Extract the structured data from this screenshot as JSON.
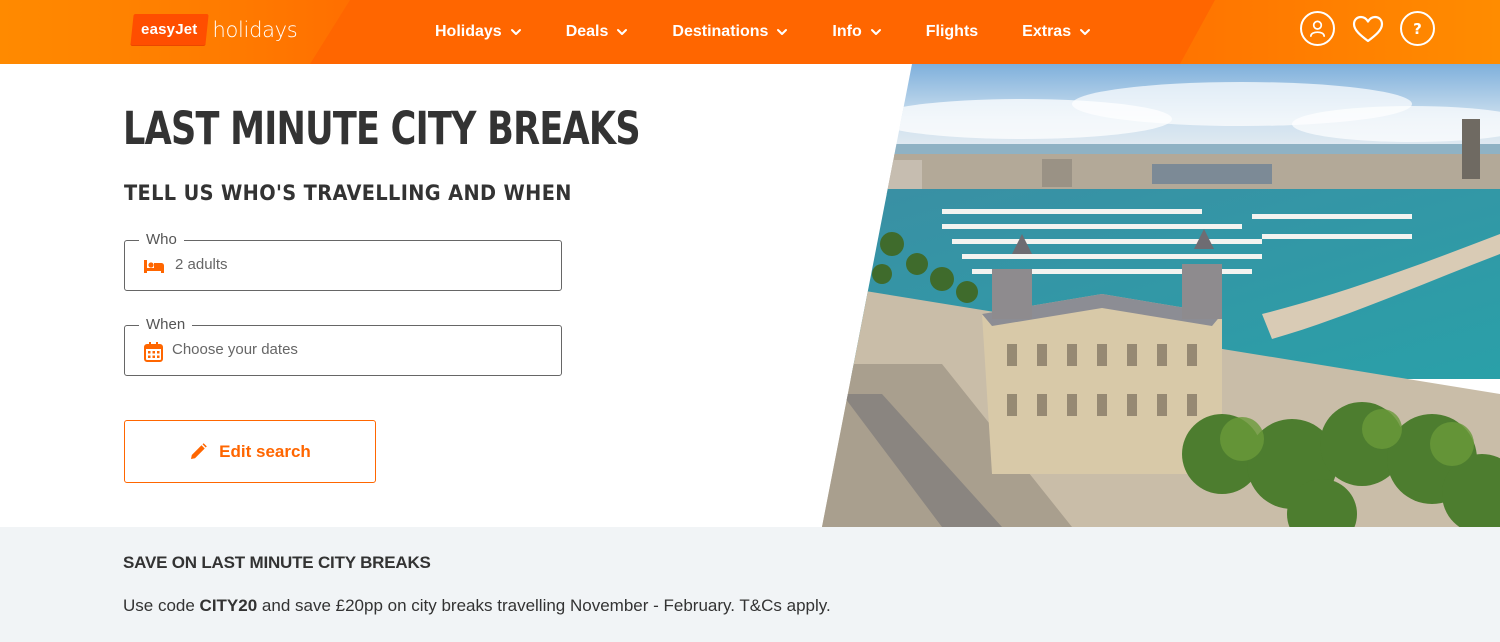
{
  "brand": {
    "logo_box": "easyJet",
    "logo_text": "holidays"
  },
  "nav": {
    "items": [
      {
        "label": "Holidays",
        "has_dropdown": true
      },
      {
        "label": "Deals",
        "has_dropdown": true
      },
      {
        "label": "Destinations",
        "has_dropdown": true
      },
      {
        "label": "Info",
        "has_dropdown": true
      },
      {
        "label": "Flights",
        "has_dropdown": false
      },
      {
        "label": "Extras",
        "has_dropdown": true
      }
    ]
  },
  "header_icons": {
    "account": "user-icon",
    "favourites": "heart-icon",
    "help": "help-icon",
    "help_glyph": "?"
  },
  "hero": {
    "title": "LAST MINUTE CITY BREAKS",
    "subtitle": "TELL US WHO'S TRAVELLING AND WHEN",
    "who": {
      "legend": "Who",
      "value": "2 adults",
      "icon": "bed-icon"
    },
    "when": {
      "legend": "When",
      "placeholder": "Choose your dates",
      "icon": "calendar-icon"
    },
    "edit_button": {
      "label": "Edit search",
      "icon": "pencil-icon"
    },
    "image_alt": "Aerial view of Port Vell harbour, Barcelona"
  },
  "promo": {
    "title": "SAVE ON LAST MINUTE CITY BREAKS",
    "text_before": "Use code ",
    "code": "CITY20",
    "text_after": " and save £20pp on city breaks travelling November - February. T&Cs apply."
  },
  "colors": {
    "brand_orange": "#ff6600",
    "text": "#333333",
    "promo_bg": "#f1f4f6"
  }
}
